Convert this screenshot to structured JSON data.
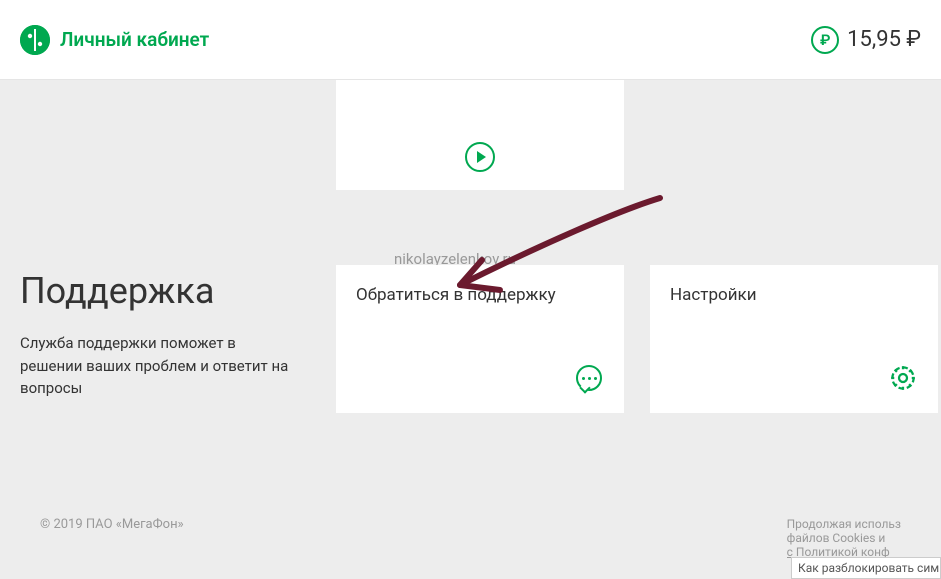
{
  "header": {
    "title": "Личный кабинет",
    "balance": "15,95 ₽",
    "ruble_symbol": "₽"
  },
  "watermark": "nikolayzelenkov.ru",
  "section": {
    "title": "Поддержка",
    "description": "Служба поддержки поможет в решении ваших проблем и ответит на вопросы"
  },
  "cards": {
    "support": {
      "title": "Обратиться в поддержку"
    },
    "settings": {
      "title": "Настройки"
    }
  },
  "footer": {
    "copyright": "© 2019 ПАО «МегаФон»",
    "disclaimer_line1": "Продолжая использ",
    "disclaimer_line2": "файлов Cookies и",
    "disclaimer_line3": "с Политикой конф"
  },
  "bottom_hint": "Как разблокировать симкар"
}
